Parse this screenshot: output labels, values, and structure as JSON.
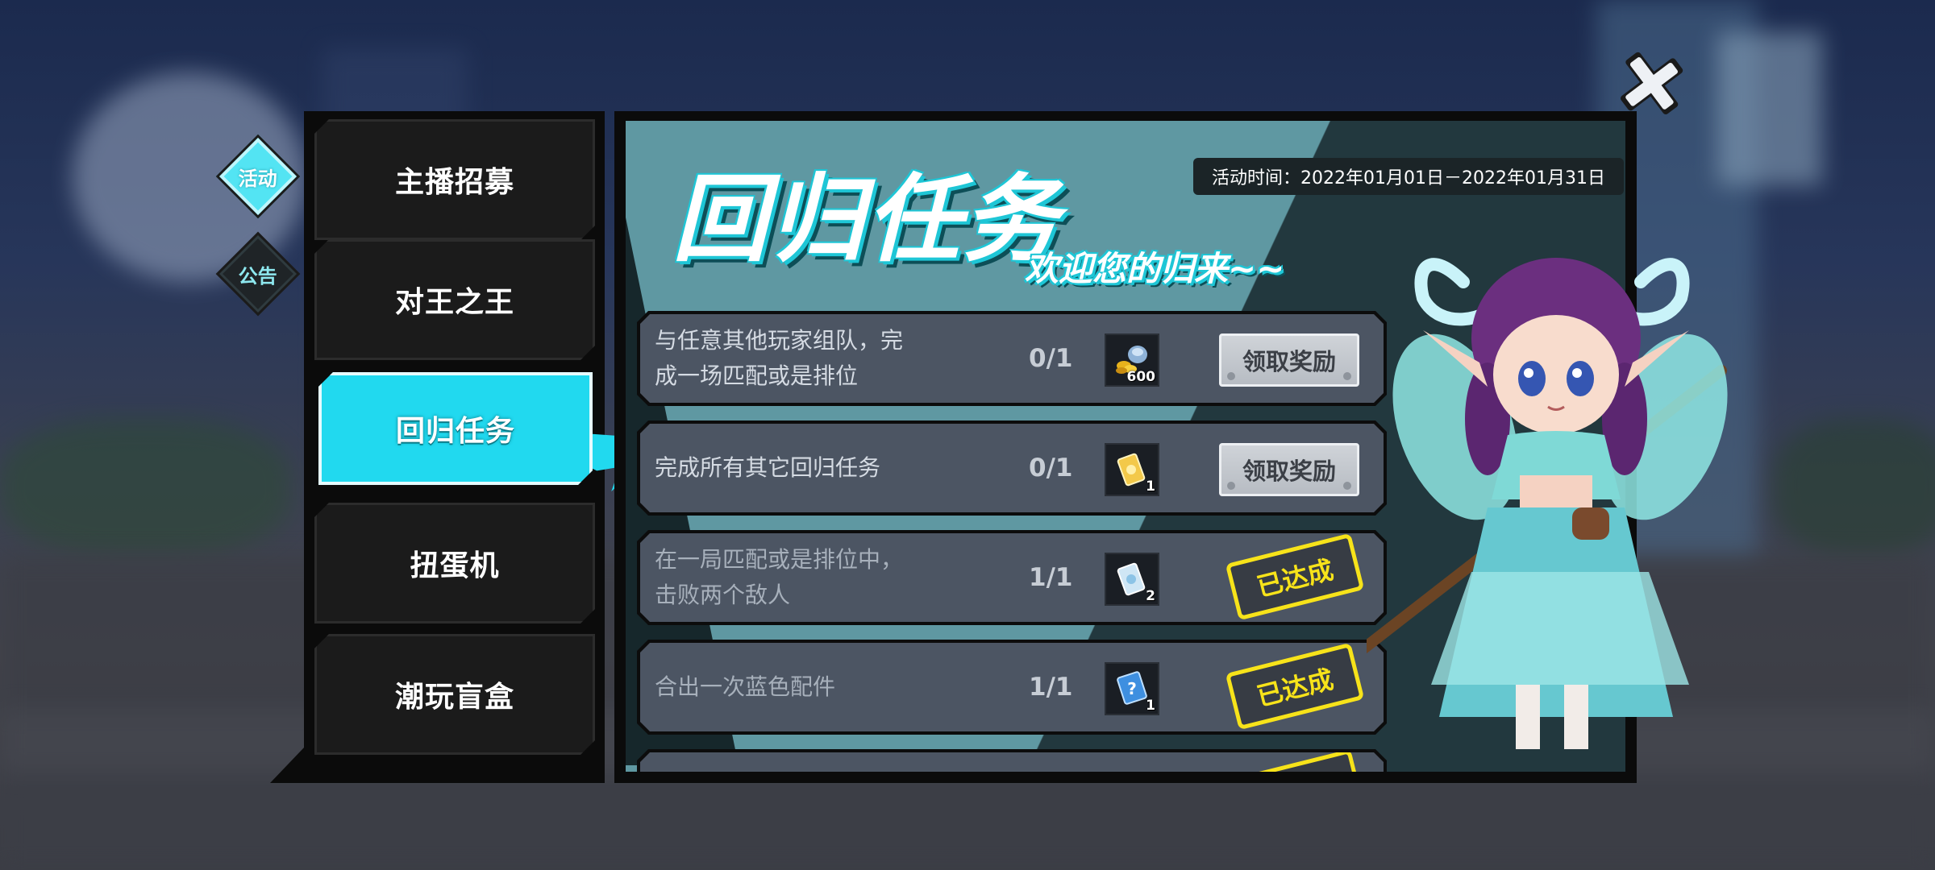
{
  "side_tabs": [
    {
      "label": "活动",
      "active": true
    },
    {
      "label": "公告",
      "active": false
    }
  ],
  "nav": {
    "items": [
      {
        "label": "主播招募",
        "active": false
      },
      {
        "label": "对王之王",
        "active": false
      },
      {
        "label": "回归任务",
        "active": true
      },
      {
        "label": "扭蛋机",
        "active": false
      },
      {
        "label": "潮玩盲盒",
        "active": false
      }
    ]
  },
  "event": {
    "title": "回归任务",
    "subtitle": "欢迎您的归来~~",
    "time_label": "活动时间：2022年01月01日－2022年01月31日"
  },
  "tasks": [
    {
      "desc_line1": "与任意其他玩家组队，完",
      "desc_line2": "成一场匹配或是排位",
      "progress": "0/1",
      "reward_icon": "coin-sack-icon",
      "reward_count": "600",
      "state": "claim",
      "action_label": "领取奖励"
    },
    {
      "desc_line1": "完成所有其它回归任务",
      "desc_line2": "",
      "progress": "0/1",
      "reward_icon": "gold-ticket-icon",
      "reward_count": "1",
      "state": "claim",
      "action_label": "领取奖励"
    },
    {
      "desc_line1": "在一局匹配或是排位中，",
      "desc_line2": "击败两个敌人",
      "progress": "1/1",
      "reward_icon": "blue-ticket-icon",
      "reward_count": "2",
      "state": "done",
      "action_label": "已达成"
    },
    {
      "desc_line1": "合出一次蓝色配件",
      "desc_line2": "",
      "progress": "1/1",
      "reward_icon": "mystery-card-icon",
      "reward_count": "1",
      "state": "done",
      "action_label": "已达成"
    }
  ],
  "colors": {
    "accent": "#21d9ef",
    "stamp": "#f7e31a",
    "row_bg": "#4c5563"
  }
}
